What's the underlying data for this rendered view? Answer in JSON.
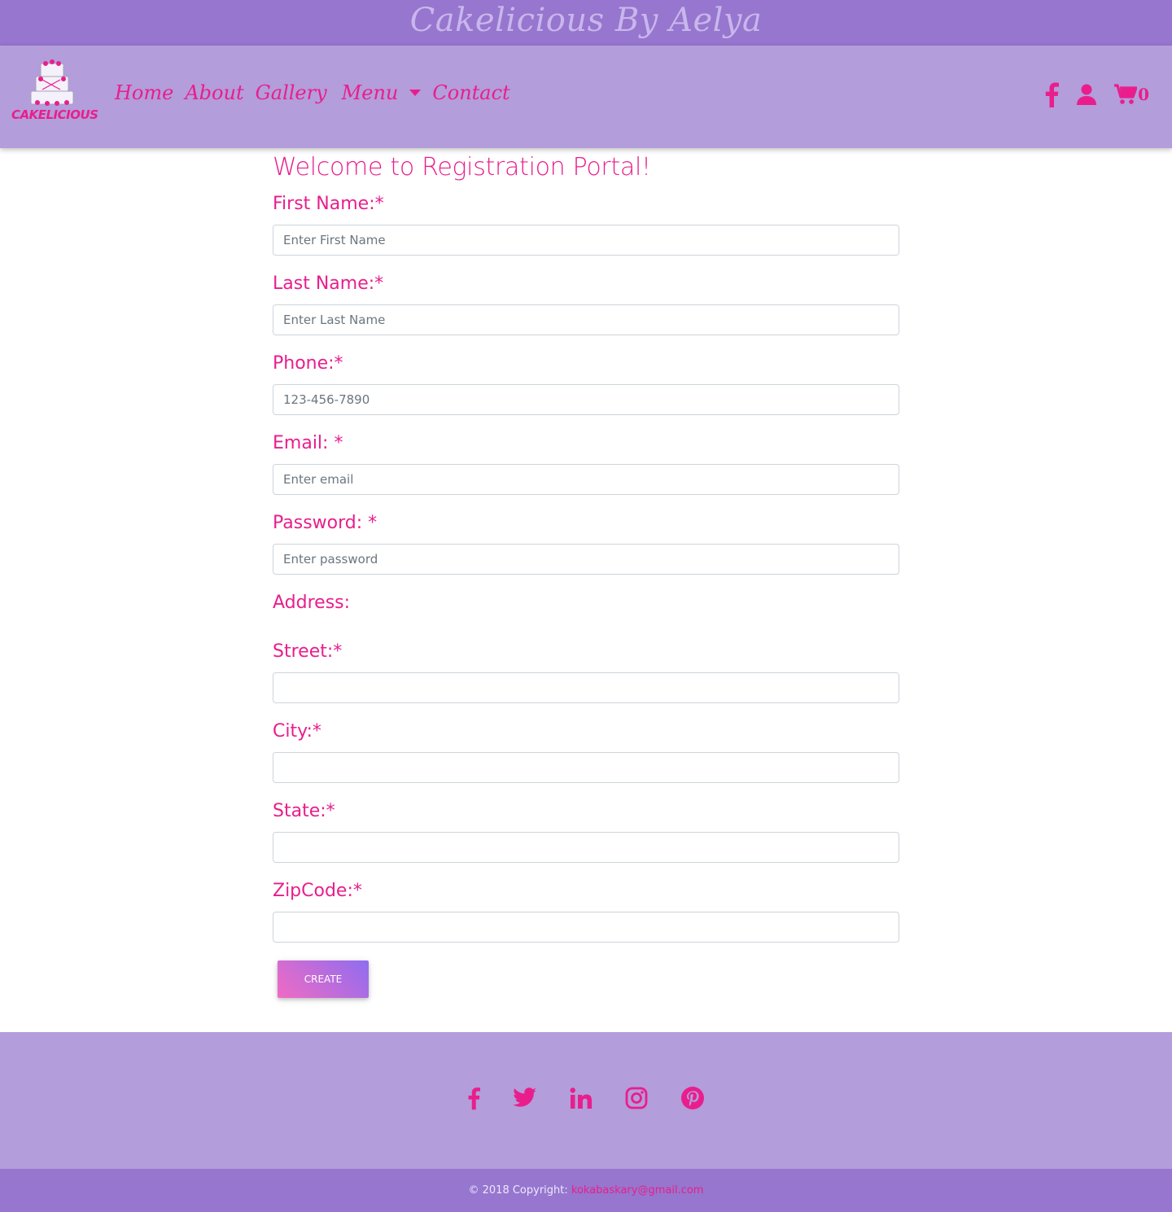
{
  "banner": {
    "title": "Cakelicious By Aelya"
  },
  "logo": {
    "text": "CAKELICIOUS"
  },
  "nav": {
    "links": [
      "Home",
      "About",
      "Gallery",
      "Menu",
      "Contact"
    ],
    "cart_count": "0"
  },
  "form": {
    "title": "Welcome to Registration Portal!",
    "fields": [
      {
        "label": "First Name:*",
        "placeholder": "Enter First Name",
        "value": ""
      },
      {
        "label": "Last Name:*",
        "placeholder": "Enter Last Name",
        "value": ""
      },
      {
        "label": "Phone:*",
        "placeholder": "123-456-7890",
        "value": ""
      },
      {
        "label": "Email: *",
        "placeholder": "Enter email",
        "value": ""
      },
      {
        "label": "Password: *",
        "placeholder": "Enter password",
        "value": ""
      }
    ],
    "address_heading": "Address:",
    "address_fields": [
      {
        "label": "Street:*",
        "value": ""
      },
      {
        "label": "City:*",
        "value": ""
      },
      {
        "label": "State:*",
        "value": ""
      },
      {
        "label": "ZipCode:*",
        "value": ""
      }
    ],
    "submit_label": "CREATE"
  },
  "footer": {
    "social_icons": [
      "facebook-icon",
      "twitter-icon",
      "linkedin-icon",
      "instagram-icon",
      "pinterest-icon"
    ],
    "copyright": "© 2018 Copyright:",
    "email": "kokabaskary@gmail.com"
  },
  "colors": {
    "brand_pink": "#e91e8c",
    "banner_purple": "#9676ce",
    "nav_lavender": "#b39ddb"
  }
}
